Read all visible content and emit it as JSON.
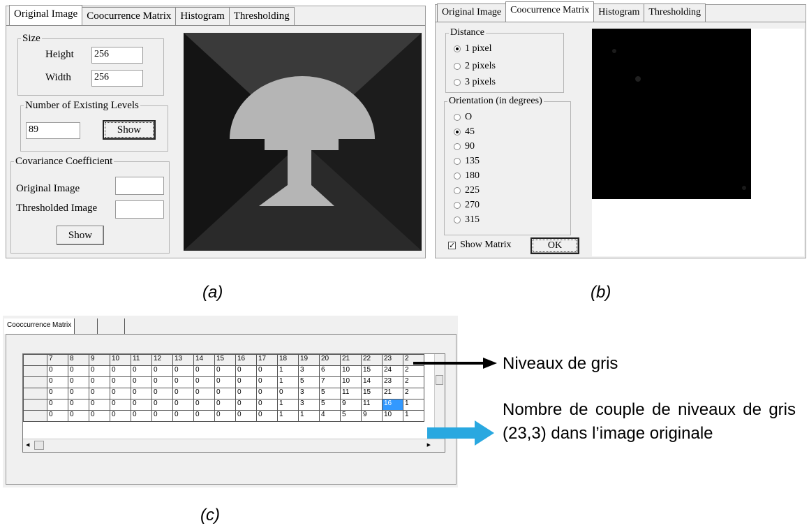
{
  "panel_a": {
    "tabs": [
      "Original Image",
      "Coocurrence Matrix",
      "Histogram",
      "Thresholding"
    ],
    "size_group": {
      "legend": "Size",
      "height_label": "Height",
      "height_value": "256",
      "width_label": "Width",
      "width_value": "256"
    },
    "levels_group": {
      "legend": "Number of Existing Levels",
      "value": "89",
      "button": "Show"
    },
    "covariance_group": {
      "legend": "Covariance Coefficient",
      "original_label": "Original  Image",
      "thresholded_label": "Thresholded Image",
      "button": "Show"
    }
  },
  "panel_b": {
    "tabs": [
      "Original Image",
      "Coocurrence Matrix",
      "Histogram",
      "Thresholding"
    ],
    "distance": {
      "legend": "Distance",
      "options": [
        "1 pixel",
        "2 pixels",
        "3 pixels"
      ],
      "selected": "1 pixel"
    },
    "orientation": {
      "legend": "Orientation (in degrees)",
      "options": [
        "O",
        "45",
        "90",
        "135",
        "180",
        "225",
        "270",
        "315"
      ],
      "selected": "45"
    },
    "show_matrix": {
      "label": "Show Matrix",
      "checked": true
    },
    "ok_button": "OK"
  },
  "panel_c": {
    "tab": "Cooccurrence Matrix",
    "headers": [
      "7",
      "8",
      "9",
      "10",
      "11",
      "12",
      "13",
      "14",
      "15",
      "16",
      "17",
      "18",
      "19",
      "20",
      "21",
      "22",
      "23",
      "2"
    ],
    "rows": [
      [
        "0",
        "0",
        "0",
        "0",
        "0",
        "0",
        "0",
        "0",
        "0",
        "0",
        "0",
        "1",
        "3",
        "6",
        "10",
        "15",
        "24",
        "2"
      ],
      [
        "0",
        "0",
        "0",
        "0",
        "0",
        "0",
        "0",
        "0",
        "0",
        "0",
        "0",
        "1",
        "5",
        "7",
        "10",
        "14",
        "23",
        "2"
      ],
      [
        "0",
        "0",
        "0",
        "0",
        "0",
        "0",
        "0",
        "0",
        "0",
        "0",
        "0",
        "0",
        "3",
        "5",
        "11",
        "15",
        "21",
        "2"
      ],
      [
        "0",
        "0",
        "0",
        "0",
        "0",
        "0",
        "0",
        "0",
        "0",
        "0",
        "0",
        "1",
        "3",
        "5",
        "9",
        "11",
        "16",
        "1"
      ],
      [
        "0",
        "0",
        "0",
        "0",
        "0",
        "0",
        "0",
        "0",
        "0",
        "0",
        "0",
        "1",
        "1",
        "4",
        "5",
        "9",
        "10",
        "1"
      ]
    ],
    "selected_value": "16"
  },
  "captions": {
    "a": "(a)",
    "b": "(b)",
    "c": "(c)"
  },
  "annotations": {
    "gray_levels": "Niveaux de gris",
    "pair_count": "Nombre de couple de niveaux de gris (23,3) dans l’image originale"
  },
  "colors": {
    "arrow_black": "#000000",
    "arrow_blue": "#29a8e0",
    "selection": "#3399ff"
  }
}
